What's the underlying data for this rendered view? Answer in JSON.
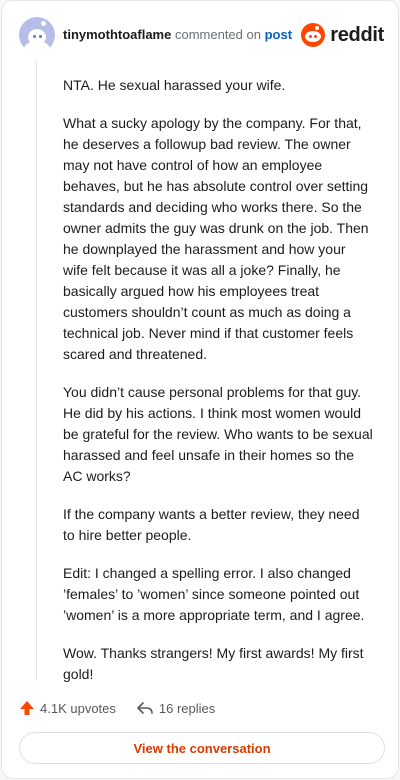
{
  "header": {
    "username": "tinymothtoaflame",
    "action_text": "commented on",
    "post_link": "post",
    "brand": "reddit"
  },
  "comment": {
    "paragraphs": [
      "NTA. He sexual harassed your wife.",
      "What a sucky apology by the company. For that, he deserves a followup bad review. The owner may not have control of how an employee behaves, but he has absolute control over setting standards and deciding who works there. So the owner admits the guy was drunk on the job. Then he downplayed the harassment and how your wife felt because it was all a joke? Finally, he basically argued how his employees treat customers shouldn’t count as much as doing a technical job. Never mind if that customer feels scared and threatened.",
      "You didn’t cause personal problems for that guy. He did by his actions. I think most women would be grateful for the review. Who wants to be sexual harassed and feel unsafe in their homes so the AC works?",
      "If the company wants a better review, they need to hire better people.",
      "Edit: I changed a spelling error. I also changed ’females’ to ’women’ since someone pointed out ’women’ is a more appropriate term, and I agree.",
      "Wow. Thanks strangers! My first awards! My first gold!"
    ]
  },
  "actions": {
    "upvotes": "4.1K upvotes",
    "replies": "16 replies"
  },
  "view_button": "View the conversation",
  "colors": {
    "upvote": "#ff4500",
    "link": "#0a5fbb",
    "button_text": "#d93a00"
  }
}
